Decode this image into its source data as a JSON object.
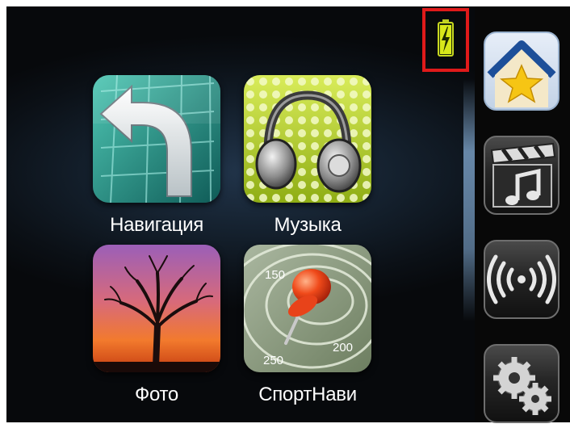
{
  "apps": [
    {
      "label": "Навигация",
      "icon": "navigation-turn-arrow-icon"
    },
    {
      "label": "Музыка",
      "icon": "headphones-icon"
    },
    {
      "label": "Фото",
      "icon": "tree-sunset-photo-icon"
    },
    {
      "label": "СпортНави",
      "icon": "pushpin-contour-map-icon"
    }
  ],
  "sportnavi_contours": [
    "150",
    "200",
    "250"
  ],
  "sidebar": [
    {
      "icon": "home-star-icon",
      "active": true
    },
    {
      "icon": "clapper-music-icon",
      "active": false
    },
    {
      "icon": "wireless-signal-icon",
      "active": false
    },
    {
      "icon": "gears-settings-icon",
      "active": false
    }
  ],
  "status": {
    "battery_icon": "battery-charging-icon",
    "highlight_color": "#e01a1a"
  },
  "colors": {
    "battery_green": "#d8e81a",
    "glow": "#9cc6f0"
  }
}
